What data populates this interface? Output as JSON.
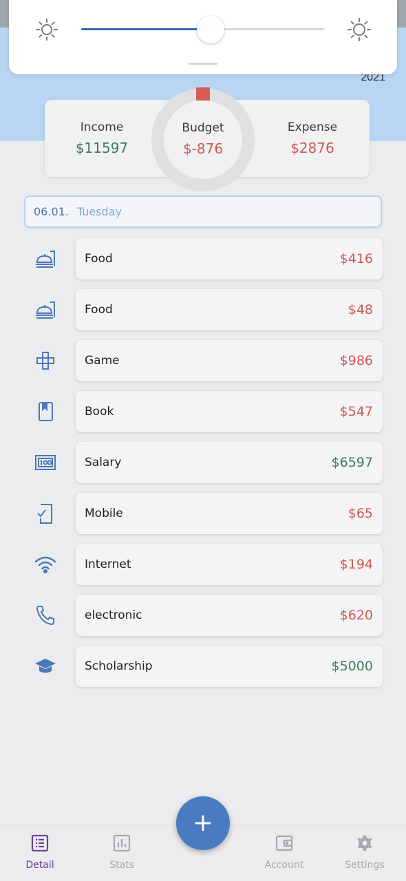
{
  "header": {
    "year": "2021"
  },
  "brightness": {
    "level": 0.53
  },
  "summary": {
    "income_label": "Income",
    "income_value": "$11597",
    "budget_label": "Budget",
    "budget_value": "$-876",
    "expense_label": "Expense",
    "expense_value": "$2876"
  },
  "date_header": {
    "date": "06.01.",
    "weekday": "Tuesday"
  },
  "transactions": [
    {
      "name": "Food",
      "amount": "$416",
      "type": "expense",
      "icon": "food-icon"
    },
    {
      "name": "Food",
      "amount": "$48",
      "type": "expense",
      "icon": "food-icon"
    },
    {
      "name": "Game",
      "amount": "$986",
      "type": "expense",
      "icon": "gamepad-icon"
    },
    {
      "name": "Book",
      "amount": "$547",
      "type": "expense",
      "icon": "book-icon"
    },
    {
      "name": "Salary",
      "amount": "$6597",
      "type": "income",
      "icon": "salary-icon"
    },
    {
      "name": "Mobile",
      "amount": "$65",
      "type": "expense",
      "icon": "mobile-icon"
    },
    {
      "name": "Internet",
      "amount": "$194",
      "type": "expense",
      "icon": "wifi-icon"
    },
    {
      "name": "electronic",
      "amount": "$620",
      "type": "expense",
      "icon": "phone-icon"
    },
    {
      "name": "Scholarship",
      "amount": "$5000",
      "type": "income",
      "icon": "graduation-cap-icon"
    }
  ],
  "nav": {
    "items": [
      {
        "label": "Detail",
        "icon": "list-icon",
        "active": true
      },
      {
        "label": "Stats",
        "icon": "chart-icon",
        "active": false
      },
      {
        "label": "Account",
        "icon": "wallet-icon",
        "active": false
      },
      {
        "label": "Settings",
        "icon": "gear-icon",
        "active": false
      }
    ],
    "fab_label": "+"
  },
  "colors": {
    "accent": "#4a7bc0",
    "income": "#3f7a55",
    "expense": "#d0584f",
    "active_nav": "#6b3fa0",
    "icon": "#4a78b8"
  }
}
